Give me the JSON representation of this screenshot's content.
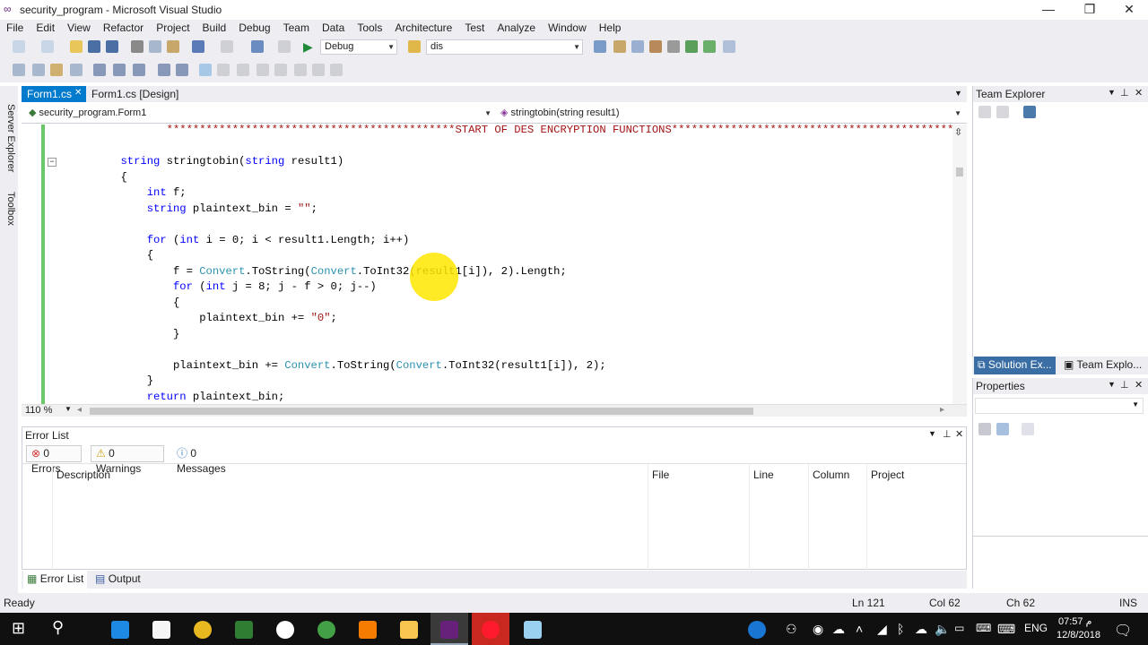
{
  "window": {
    "title": "security_program - Microsoft Visual Studio",
    "min_glyph": "—",
    "max_glyph": "❐",
    "close_glyph": "✕"
  },
  "menu": [
    "File",
    "Edit",
    "View",
    "Refactor",
    "Project",
    "Build",
    "Debug",
    "Team",
    "Data",
    "Tools",
    "Architecture",
    "Test",
    "Analyze",
    "Window",
    "Help"
  ],
  "toolbar": {
    "config": "Debug",
    "find_value": "dis"
  },
  "left_tabs": [
    "Server Explorer",
    "Toolbox"
  ],
  "doc_tabs": [
    {
      "label": "Form1.cs",
      "active": true,
      "close": "✕"
    },
    {
      "label": "Form1.cs [Design]",
      "active": false
    }
  ],
  "nav": {
    "class_combo": "security_program.Form1",
    "member_combo": "stringtobin(string result1)"
  },
  "code_lines": [
    {
      "segments": [
        {
          "t": "                  ********************************************START OF DES ENCRYPTION FUNCTIONS***********************************************",
          "c": "str"
        }
      ]
    },
    {
      "segments": []
    },
    {
      "segments": [
        {
          "t": "           ",
          "c": ""
        },
        {
          "t": "string",
          "c": "kw"
        },
        {
          "t": " stringtobin(",
          "c": ""
        },
        {
          "t": "string",
          "c": "kw"
        },
        {
          "t": " result1)",
          "c": ""
        }
      ]
    },
    {
      "segments": [
        {
          "t": "           {",
          "c": ""
        }
      ]
    },
    {
      "segments": [
        {
          "t": "               ",
          "c": ""
        },
        {
          "t": "int",
          "c": "kw"
        },
        {
          "t": " f;",
          "c": ""
        }
      ]
    },
    {
      "segments": [
        {
          "t": "               ",
          "c": ""
        },
        {
          "t": "string",
          "c": "kw"
        },
        {
          "t": " plaintext_bin = ",
          "c": ""
        },
        {
          "t": "\"\"",
          "c": "str"
        },
        {
          "t": ";",
          "c": ""
        }
      ]
    },
    {
      "segments": []
    },
    {
      "segments": [
        {
          "t": "               ",
          "c": ""
        },
        {
          "t": "for",
          "c": "kw"
        },
        {
          "t": " (",
          "c": ""
        },
        {
          "t": "int",
          "c": "kw"
        },
        {
          "t": " i = 0; i < result1.Length; i++)",
          "c": ""
        }
      ]
    },
    {
      "segments": [
        {
          "t": "               {",
          "c": ""
        }
      ]
    },
    {
      "segments": [
        {
          "t": "                   f = ",
          "c": ""
        },
        {
          "t": "Convert",
          "c": "ty"
        },
        {
          "t": ".ToString(",
          "c": ""
        },
        {
          "t": "Convert",
          "c": "ty"
        },
        {
          "t": ".ToInt32(result1[i]), 2).Length;",
          "c": ""
        }
      ]
    },
    {
      "segments": [
        {
          "t": "                   ",
          "c": ""
        },
        {
          "t": "for",
          "c": "kw"
        },
        {
          "t": " (",
          "c": ""
        },
        {
          "t": "int",
          "c": "kw"
        },
        {
          "t": " j = 8; j - f > 0; j--)",
          "c": ""
        }
      ]
    },
    {
      "segments": [
        {
          "t": "                   {",
          "c": ""
        }
      ]
    },
    {
      "segments": [
        {
          "t": "                       plaintext_bin += ",
          "c": ""
        },
        {
          "t": "\"0\"",
          "c": "str"
        },
        {
          "t": ";",
          "c": ""
        }
      ]
    },
    {
      "segments": [
        {
          "t": "                   }",
          "c": ""
        }
      ]
    },
    {
      "segments": []
    },
    {
      "segments": [
        {
          "t": "                   plaintext_bin += ",
          "c": ""
        },
        {
          "t": "Convert",
          "c": "ty"
        },
        {
          "t": ".ToString(",
          "c": ""
        },
        {
          "t": "Convert",
          "c": "ty"
        },
        {
          "t": ".ToInt32(result1[i]), 2);",
          "c": ""
        }
      ]
    },
    {
      "segments": [
        {
          "t": "               }",
          "c": ""
        }
      ]
    },
    {
      "segments": [
        {
          "t": "               ",
          "c": ""
        },
        {
          "t": "return",
          "c": "kw"
        },
        {
          "t": " plaintext_bin;",
          "c": ""
        }
      ]
    }
  ],
  "zoom": "110 %",
  "error_list": {
    "title": "Error List",
    "errors": "0 Errors",
    "warnings": "0 Warnings",
    "messages": "0 Messages",
    "columns": [
      "Description",
      "File",
      "Line",
      "Column",
      "Project"
    ]
  },
  "bottom_tabs": [
    "Error List",
    "Output"
  ],
  "right_panels": {
    "team_explorer": "Team Explorer",
    "tab_solution": "Solution Ex...",
    "tab_team": "Team Explo...",
    "properties": "Properties"
  },
  "status": {
    "ready": "Ready",
    "ln": "Ln 121",
    "col": "Col 62",
    "ch": "Ch 62",
    "ins": "INS"
  },
  "taskbar": {
    "lang": "ENG",
    "time": "07:57 م",
    "date": "12/8/2018"
  },
  "colors": {
    "accent": "#007acc",
    "keyword": "#0000ff",
    "type": "#2b91af",
    "string": "#a31515"
  }
}
